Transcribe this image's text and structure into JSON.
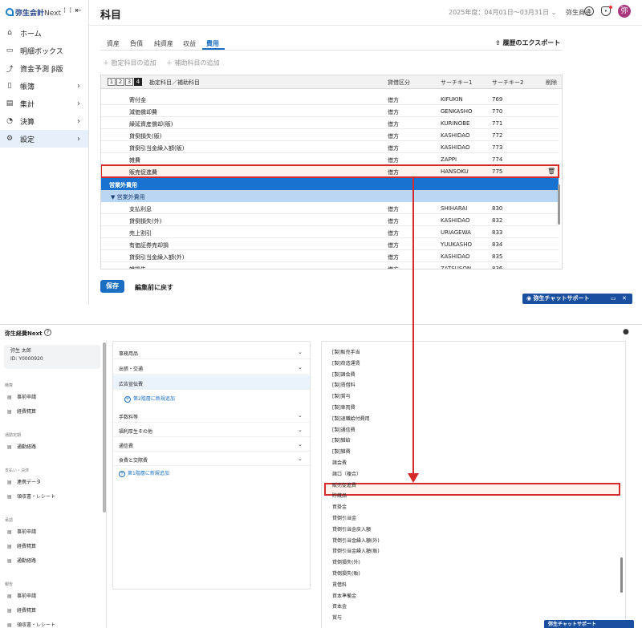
{
  "top": {
    "logo": "弥生会計",
    "logo_suffix": "Next",
    "nav": [
      {
        "label": "ホーム",
        "icon": "home-icon",
        "glyph": "⌂",
        "chev": ""
      },
      {
        "label": "明細ボックス",
        "icon": "box-icon",
        "glyph": "▭",
        "chev": ""
      },
      {
        "label": "資金予測 β版",
        "icon": "chart-icon",
        "glyph": "⤴",
        "chev": ""
      },
      {
        "label": "帳簿",
        "icon": "book-icon",
        "glyph": "▯",
        "chev": "›"
      },
      {
        "label": "集計",
        "icon": "report-icon",
        "glyph": "▤",
        "chev": "›"
      },
      {
        "label": "決算",
        "icon": "settle-icon",
        "glyph": "◔",
        "chev": "›"
      },
      {
        "label": "設定",
        "icon": "gear-icon",
        "glyph": "⚙",
        "chev": "›"
      }
    ],
    "page_title": "科目",
    "fiscal_year": "2025年度：04月01日〜03月31日",
    "company": "弥生商会",
    "avatar": "弥",
    "tabs": [
      "資産",
      "負債",
      "純資産",
      "収益",
      "費用"
    ],
    "export_label": "履歴のエクスポート",
    "add_account": "勘定科目の追加",
    "add_sub_account": "補助科目の追加",
    "columns": {
      "levels": [
        "1",
        "2",
        "3",
        "4"
      ],
      "name": "勘定科目／補助科目",
      "side": "貸借区分",
      "key1": "サーチキー1",
      "key2": "サーチキー2",
      "del": "削除"
    },
    "rows_a": [
      {
        "name": "寄付金",
        "side": "借方",
        "k1": "KIFUKIN",
        "k2": "769"
      },
      {
        "name": "減価償却費",
        "side": "借方",
        "k1": "GENKASHO",
        "k2": "770"
      },
      {
        "name": "繰延資産償却(販)",
        "side": "借方",
        "k1": "KURINOBE",
        "k2": "771"
      },
      {
        "name": "貸倒損失(販)",
        "side": "借方",
        "k1": "KASHIDAO",
        "k2": "772"
      },
      {
        "name": "貸倒引当金繰入額(販)",
        "side": "借方",
        "k1": "KASHIDAO",
        "k2": "773"
      },
      {
        "name": "雑費",
        "side": "借方",
        "k1": "ZAPPI",
        "k2": "774"
      },
      {
        "name": "販売促進費",
        "side": "借方",
        "k1": "HANSOKU",
        "k2": "775"
      }
    ],
    "band1": "営業外費用",
    "band2": "▼ 営業外費用",
    "rows_b": [
      {
        "name": "支払利息",
        "side": "借方",
        "k1": "SHIHARAI",
        "k2": "830"
      },
      {
        "name": "貸倒損失(外)",
        "side": "借方",
        "k1": "KASHIDAO",
        "k2": "832"
      },
      {
        "name": "売上割引",
        "side": "借方",
        "k1": "URIAGEWA",
        "k2": "833"
      },
      {
        "name": "有価証券売却損",
        "side": "借方",
        "k1": "YUUKASHO",
        "k2": "834"
      },
      {
        "name": "貸倒引当金繰入額(外)",
        "side": "借方",
        "k1": "KASHIDAO",
        "k2": "835"
      },
      {
        "name": "雑損失",
        "side": "借方",
        "k1": "ZATSUSON",
        "k2": "836"
      }
    ],
    "save": "保存",
    "back": "編集前に戻す",
    "chat": "弥生チャットサポート"
  },
  "bottom": {
    "title": "弥生経費Next",
    "user_name": "弥生 太郎",
    "user_id": "ID: Y0000920",
    "sections": [
      {
        "label": "精算",
        "items": [
          "事前申請",
          "経費精算"
        ]
      },
      {
        "label": "通勤定期",
        "items": [
          "通勤経路"
        ]
      },
      {
        "label": "支払い・決済",
        "items": [
          "連携データ",
          "領収書・レシート"
        ]
      },
      {
        "label": "承認",
        "items": [
          "事前申請",
          "経費精算",
          "通勤経路"
        ]
      },
      {
        "label": "報告",
        "items": [
          "事前申請",
          "経費精算",
          "領収書・レシート"
        ]
      }
    ],
    "categories": [
      "事務用品",
      "出張・交通",
      "広告宣伝費"
    ],
    "add_level2": "第2階層に新規追加",
    "categories2": [
      "手数料等",
      "福利厚生その他",
      "通信費",
      "食費と交際費"
    ],
    "add_level1": "第1階層に新規追加",
    "accounts": [
      "[製]販売手当",
      "[製]荷造運賃",
      "[製]諸会費",
      "[製]賃借料",
      "[製]賞与",
      "[製]車両費",
      "[製]退職給付費用",
      "[製]通信費",
      "[製]雑給",
      "[製]雑費",
      "諸会費",
      "諸口（複合）",
      "販売促進費",
      "貯蔵品",
      "買掛金",
      "貸倒引当金",
      "貸倒引当金戻入額",
      "貸倒引当金繰入額(外)",
      "貸倒引当金繰入額(販)",
      "貸倒損失(外)",
      "貸倒損失(販)",
      "賃借料",
      "資本準備金",
      "資本金",
      "賞与"
    ],
    "chat": "弥生チャットサポート"
  }
}
